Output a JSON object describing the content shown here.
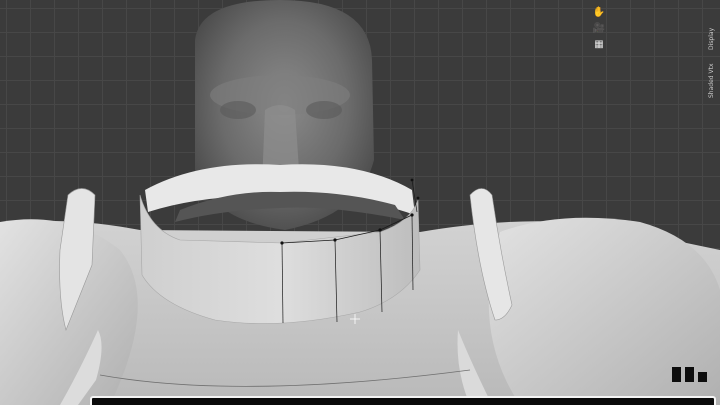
{
  "app": {
    "name": "3D sculpting viewport"
  },
  "viewport": {
    "grid_color": "#474747",
    "background_color": "#3b3b3b",
    "model_color": "#c8c8c8"
  },
  "navigation_gizmo": [
    {
      "icon": "hand-pan-icon",
      "glyph": "✋"
    },
    {
      "icon": "camera-icon",
      "glyph": "🎥"
    },
    {
      "icon": "grid-view-icon",
      "glyph": "▦"
    }
  ],
  "side_labels": [
    "Display",
    "Shaded Vtx"
  ],
  "overlay": {
    "accent": "#ffffff"
  }
}
